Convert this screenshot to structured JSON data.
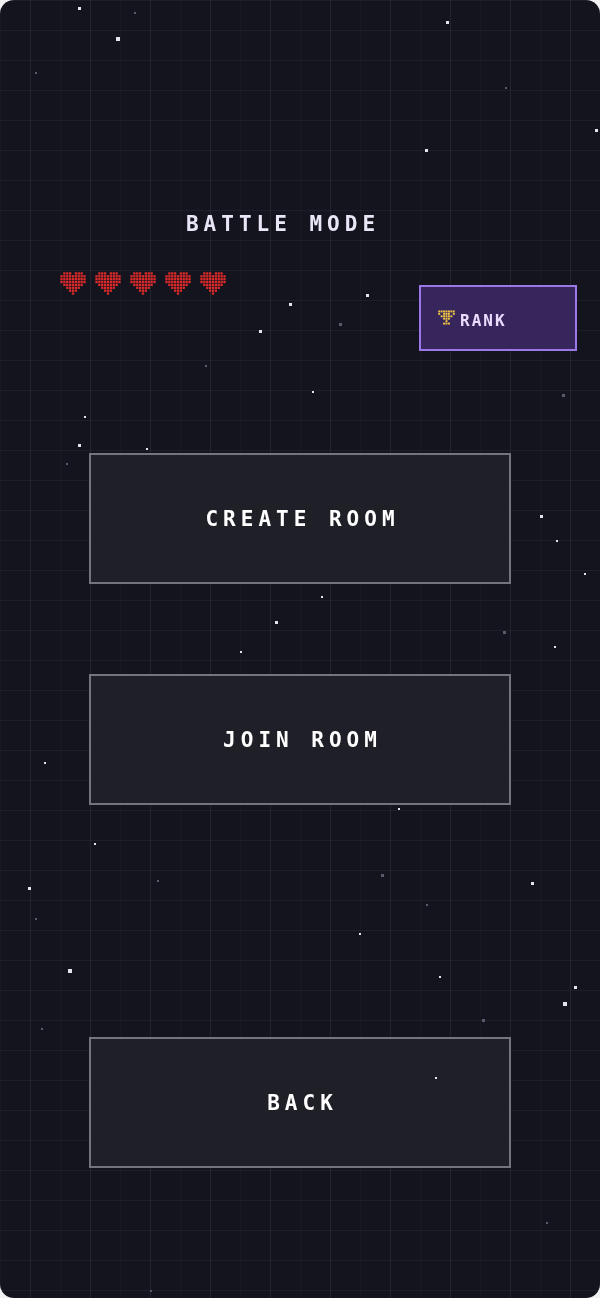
{
  "title": "BATTLE MODE",
  "hearts": [
    {
      "filled": true
    },
    {
      "filled": true
    },
    {
      "filled": true
    },
    {
      "filled": true
    },
    {
      "filled": true
    }
  ],
  "rank_button": {
    "label": "RANK"
  },
  "menu_buttons": [
    {
      "label": "CREATE ROOM"
    },
    {
      "label": "JOIN ROOM"
    }
  ],
  "back_button": {
    "label": "BACK"
  }
}
